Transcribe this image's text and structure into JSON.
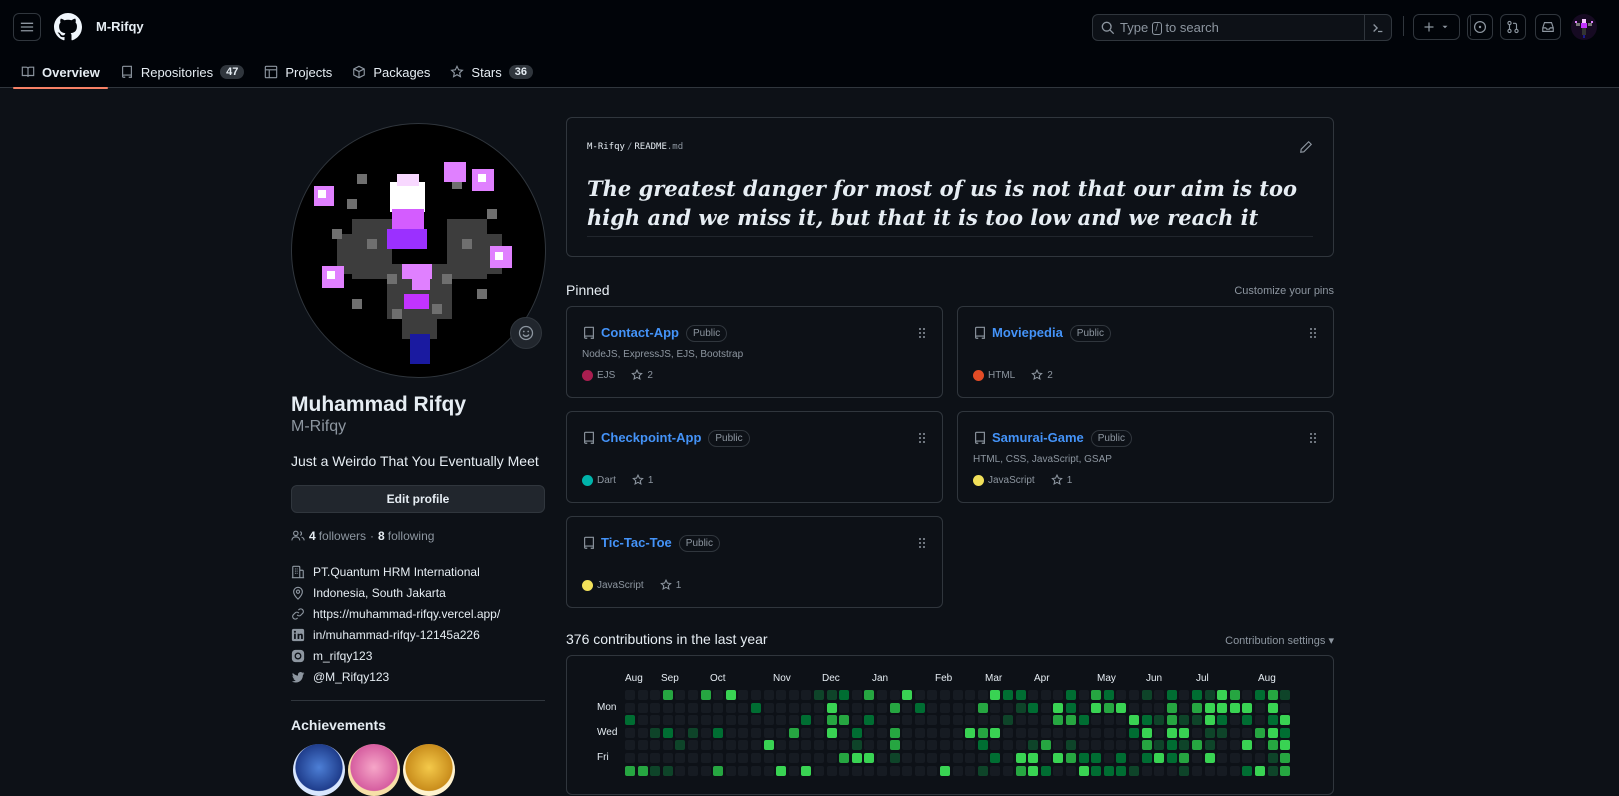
{
  "header": {
    "username": "M-Rifqy",
    "search_prefix": "Type",
    "search_key": "/",
    "search_suffix": "to search"
  },
  "tabs": [
    {
      "label": "Overview"
    },
    {
      "label": "Repositories",
      "count": "47"
    },
    {
      "label": "Projects"
    },
    {
      "label": "Packages"
    },
    {
      "label": "Stars",
      "count": "36"
    }
  ],
  "profile": {
    "name": "Muhammad Rifqy",
    "login": "M-Rifqy",
    "bio": "Just a Weirdo That You Eventually Meet",
    "edit_label": "Edit profile",
    "followers": "4",
    "followers_label": "followers",
    "sep": "·",
    "following": "8",
    "following_label": "following",
    "company": "PT.Quantum HRM International",
    "location": "Indonesia, South Jakarta",
    "website": "https://muhammad-rifqy.vercel.app/",
    "linkedin": "in/muhammad-rifqy-12145a226",
    "instagram": "m_rifqy123",
    "twitter": "@M_Rifqy123",
    "achievements_title": "Achievements"
  },
  "readme": {
    "owner": "M-Rifqy",
    "file": "README",
    "ext": ".md",
    "quote": "The greatest danger for most of us is not that our aim is too high and we miss it, but that it is too low and we reach it"
  },
  "pinned": {
    "title": "Pinned",
    "customize": "Customize your pins",
    "visibility": "Public",
    "repos": [
      {
        "name": "Contact-App",
        "desc": "NodeJS, ExpressJS, EJS, Bootstrap",
        "lang": "EJS",
        "lang_color": "#a91e50",
        "stars": "2"
      },
      {
        "name": "Moviepedia",
        "desc": "",
        "lang": "HTML",
        "lang_color": "#e34c26",
        "stars": "2"
      },
      {
        "name": "Checkpoint-App",
        "desc": "",
        "lang": "Dart",
        "lang_color": "#00b4ab",
        "stars": "1"
      },
      {
        "name": "Samurai-Game",
        "desc": "HTML, CSS, JavaScript, GSAP",
        "lang": "JavaScript",
        "lang_color": "#f1e05a",
        "stars": "1"
      },
      {
        "name": "Tic-Tac-Toe",
        "desc": "",
        "lang": "JavaScript",
        "lang_color": "#f1e05a",
        "stars": "1"
      }
    ]
  },
  "contributions": {
    "title": "376 contributions in the last year",
    "settings": "Contribution settings",
    "months": [
      "Aug",
      "Sep",
      "Oct",
      "Nov",
      "Dec",
      "Jan",
      "Feb",
      "Mar",
      "Apr",
      "May",
      "Jun",
      "Jul",
      "Aug"
    ],
    "days": [
      "Mon",
      "Wed",
      "Fri"
    ],
    "colors": [
      "#161b22",
      "#0e4429",
      "#006d32",
      "#26a641",
      "#39d353"
    ]
  }
}
